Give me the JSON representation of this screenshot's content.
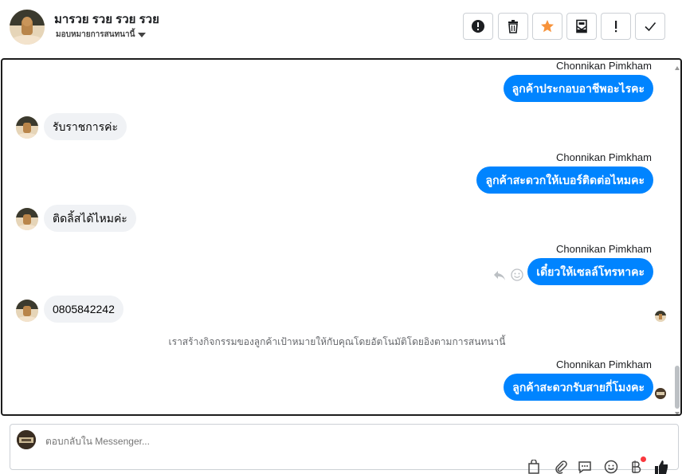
{
  "header": {
    "name": "มารวย รวย รวย รวย",
    "subtitle": "มอบหมายการสนทนานี้",
    "buttons": [
      "alert-icon",
      "trash-icon",
      "star-icon",
      "archive-icon",
      "exclamation-icon",
      "check-icon"
    ]
  },
  "messages": [
    {
      "type": "out",
      "sender": "Chonnikan Pimkham",
      "text": "ลูกค้าประกอบอาชีพอะไรคะ"
    },
    {
      "type": "in",
      "text": "รับราชการค่ะ"
    },
    {
      "type": "out",
      "sender": "Chonnikan Pimkham",
      "text": "ลูกค้าสะดวกให้เบอร์ติดต่อไหมคะ"
    },
    {
      "type": "in",
      "text": "ติดลิ้สได้ไหมค่ะ"
    },
    {
      "type": "out",
      "sender": "Chonnikan Pimkham",
      "text": "เดี๋ยวให้เซลล์โทรหาคะ"
    },
    {
      "type": "in",
      "text": "0805842242"
    },
    {
      "type": "system",
      "text": "เราสร้างกิจกรรมของลูกค้าเป้าหมายให้กับคุณโดยอัตโนมัติโดยอิงตามการสนทนานี้"
    },
    {
      "type": "out",
      "sender": "Chonnikan Pimkham",
      "text": "ลูกค้าสะดวกรับสายกี่โมงคะ"
    }
  ],
  "composer": {
    "placeholder": "ตอบกลับใน Messenger..."
  },
  "colors": {
    "bubble_out": "#0084ff",
    "bubble_in": "#f0f2f5",
    "star": "#f7923a",
    "notification_dot": "#fa383e"
  }
}
